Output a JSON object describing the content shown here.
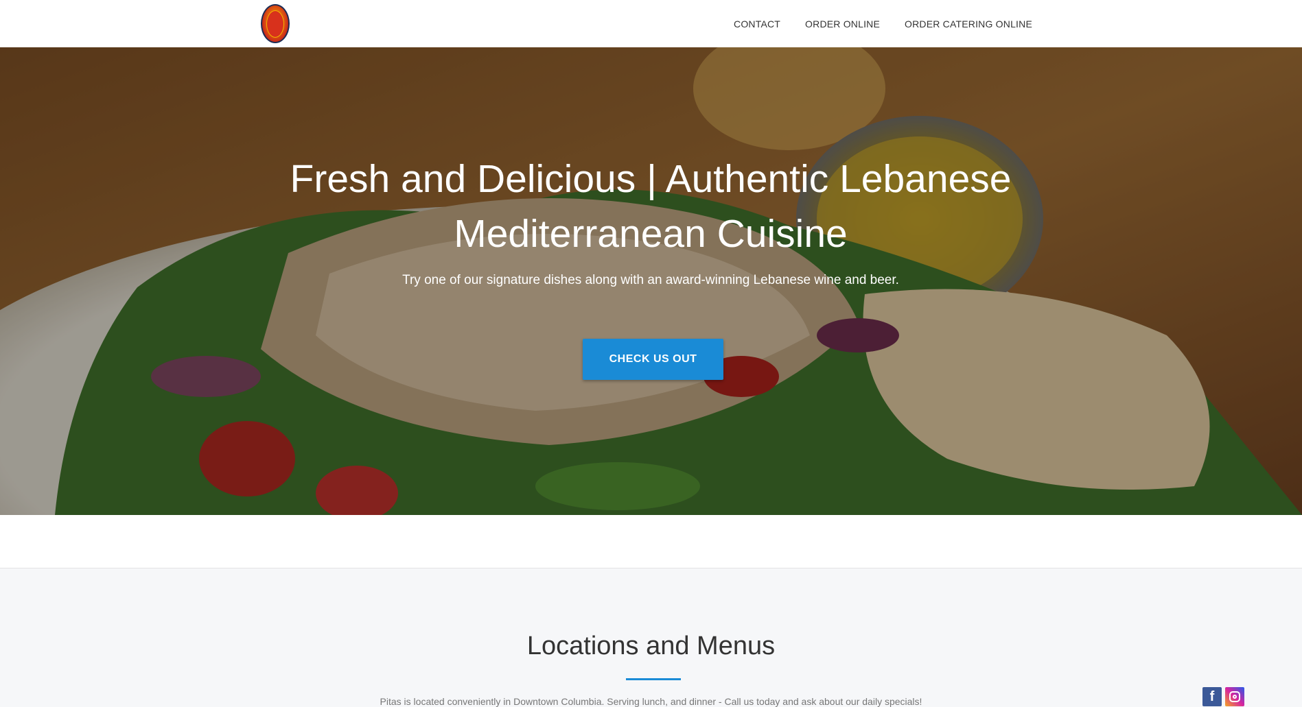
{
  "nav": {
    "links": [
      {
        "label": "CONTACT"
      },
      {
        "label": "ORDER ONLINE"
      },
      {
        "label": "ORDER CATERING ONLINE"
      }
    ]
  },
  "hero": {
    "title_line1": "Fresh and Delicious | Authentic Lebanese",
    "title_line2": "Mediterranean Cuisine",
    "subtitle": "Try one of our signature dishes along with an award-winning Lebanese wine and beer.",
    "cta_label": "CHECK US OUT"
  },
  "locations": {
    "title": "Locations and Menus",
    "text": "Pitas is located conveniently in Downtown Columbia. Serving lunch, and dinner - Call us today and ask about our daily specials!"
  },
  "social": {
    "facebook_glyph": "f"
  },
  "colors": {
    "accent": "#1a8bd6",
    "nav_text": "#333333"
  }
}
